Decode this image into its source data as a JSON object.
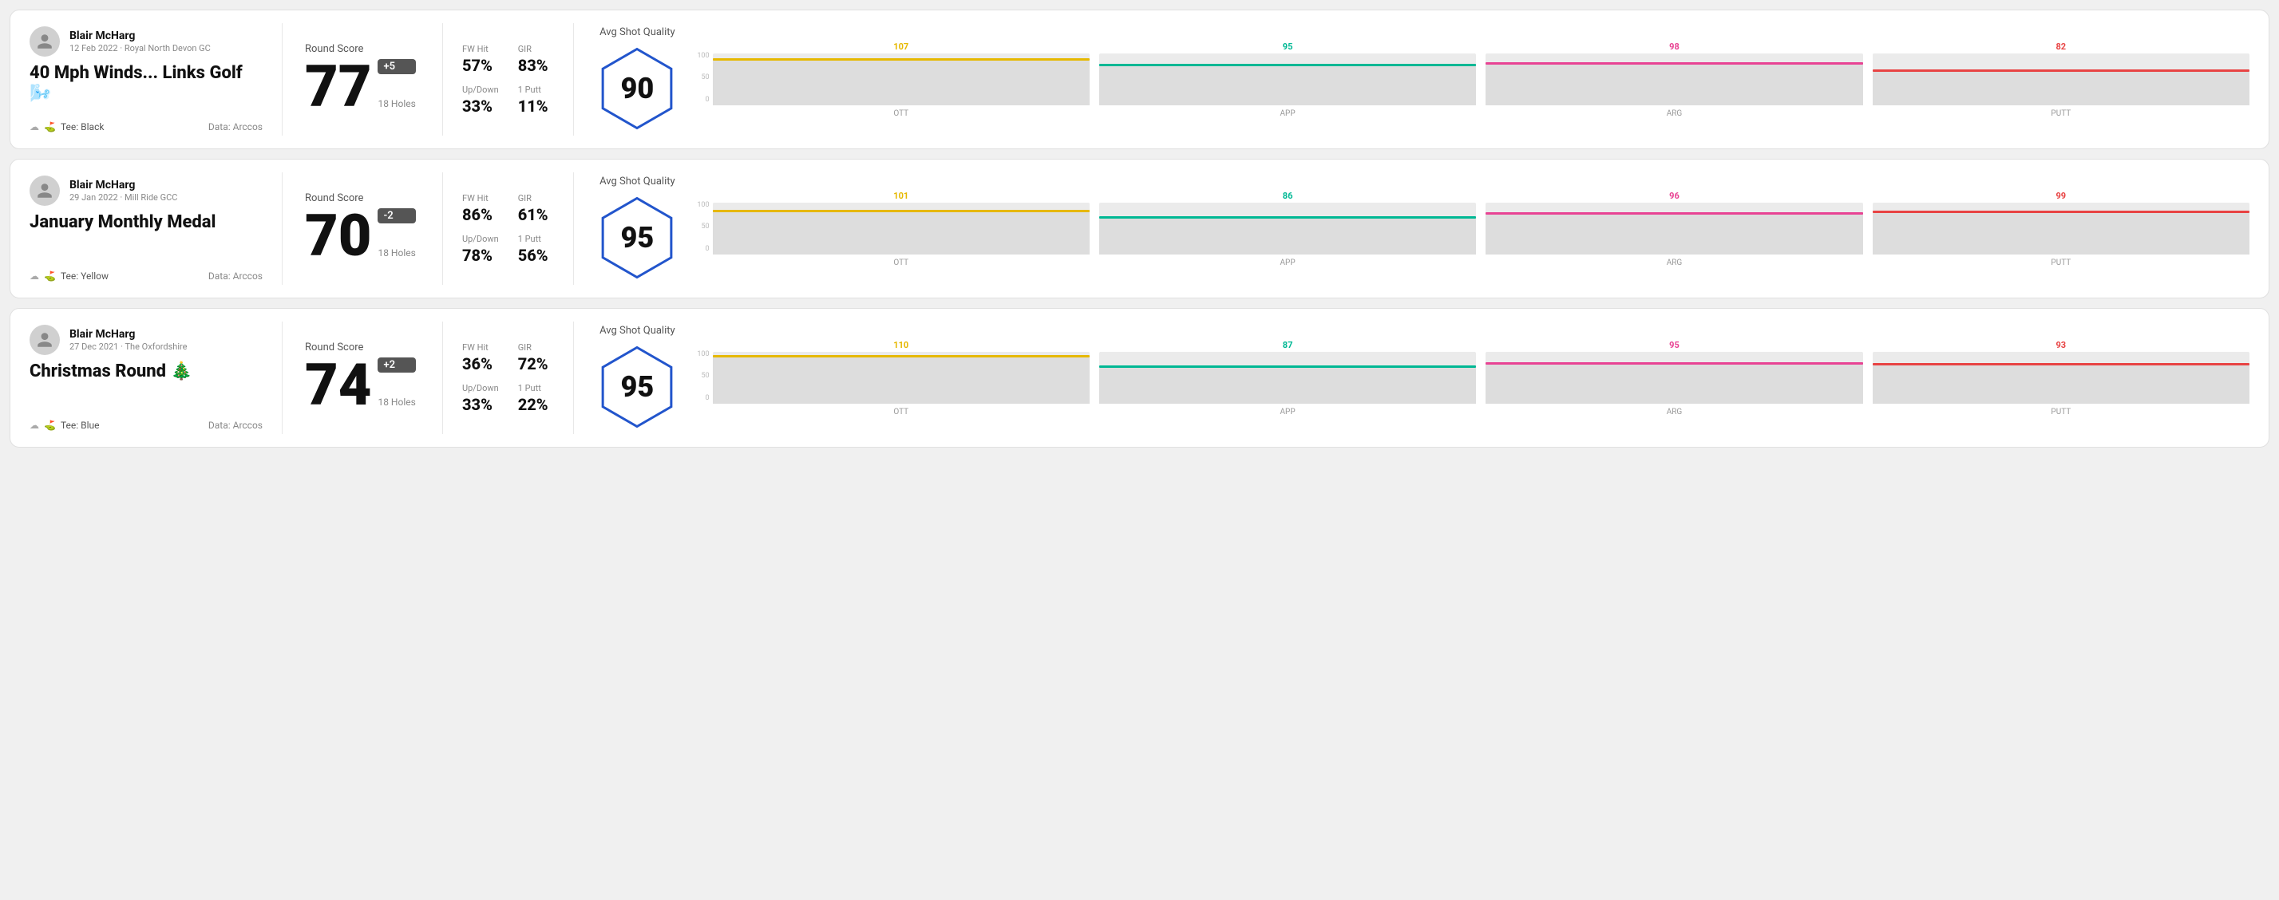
{
  "rounds": [
    {
      "id": "round-1",
      "player": {
        "name": "Blair McHarg",
        "date": "12 Feb 2022 · Royal North Devon GC"
      },
      "title": "40 Mph Winds... Links Golf 🌬️",
      "tee": "Black",
      "data_source": "Data: Arccos",
      "score": {
        "number": "77",
        "badge": "+5",
        "holes": "18 Holes"
      },
      "stats": {
        "fw_hit_label": "FW Hit",
        "fw_hit_value": "57%",
        "gir_label": "GIR",
        "gir_value": "83%",
        "updown_label": "Up/Down",
        "updown_value": "33%",
        "putt1_label": "1 Putt",
        "putt1_value": "11%"
      },
      "quality": {
        "label": "Avg Shot Quality",
        "score": "90"
      },
      "chart": {
        "ott": {
          "value": 107,
          "color": "#e6b800"
        },
        "app": {
          "value": 95,
          "color": "#00b894"
        },
        "arg": {
          "value": 98,
          "color": "#e84393"
        },
        "putt": {
          "value": 82,
          "color": "#e84343"
        }
      }
    },
    {
      "id": "round-2",
      "player": {
        "name": "Blair McHarg",
        "date": "29 Jan 2022 · Mill Ride GCC"
      },
      "title": "January Monthly Medal",
      "tee": "Yellow",
      "data_source": "Data: Arccos",
      "score": {
        "number": "70",
        "badge": "-2",
        "holes": "18 Holes"
      },
      "stats": {
        "fw_hit_label": "FW Hit",
        "fw_hit_value": "86%",
        "gir_label": "GIR",
        "gir_value": "61%",
        "updown_label": "Up/Down",
        "updown_value": "78%",
        "putt1_label": "1 Putt",
        "putt1_value": "56%"
      },
      "quality": {
        "label": "Avg Shot Quality",
        "score": "95"
      },
      "chart": {
        "ott": {
          "value": 101,
          "color": "#e6b800"
        },
        "app": {
          "value": 86,
          "color": "#00b894"
        },
        "arg": {
          "value": 96,
          "color": "#e84393"
        },
        "putt": {
          "value": 99,
          "color": "#e84343"
        }
      }
    },
    {
      "id": "round-3",
      "player": {
        "name": "Blair McHarg",
        "date": "27 Dec 2021 · The Oxfordshire"
      },
      "title": "Christmas Round 🎄",
      "tee": "Blue",
      "data_source": "Data: Arccos",
      "score": {
        "number": "74",
        "badge": "+2",
        "holes": "18 Holes"
      },
      "stats": {
        "fw_hit_label": "FW Hit",
        "fw_hit_value": "36%",
        "gir_label": "GIR",
        "gir_value": "72%",
        "updown_label": "Up/Down",
        "updown_value": "33%",
        "putt1_label": "1 Putt",
        "putt1_value": "22%"
      },
      "quality": {
        "label": "Avg Shot Quality",
        "score": "95"
      },
      "chart": {
        "ott": {
          "value": 110,
          "color": "#e6b800"
        },
        "app": {
          "value": 87,
          "color": "#00b894"
        },
        "arg": {
          "value": 95,
          "color": "#e84393"
        },
        "putt": {
          "value": 93,
          "color": "#e84343"
        }
      }
    }
  ],
  "labels": {
    "fw_hit": "FW Hit",
    "gir": "GIR",
    "updown": "Up/Down",
    "putt1": "1 Putt",
    "avg_shot_quality": "Avg Shot Quality",
    "ott": "OTT",
    "app": "APP",
    "arg": "ARG",
    "putt": "PUTT",
    "data_arccos": "Data: Arccos",
    "tee": "Tee:"
  }
}
